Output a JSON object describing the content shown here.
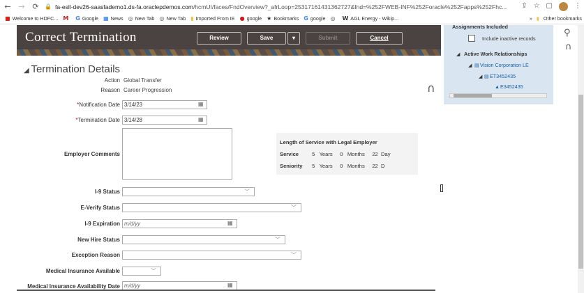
{
  "browser": {
    "url_prefix": "fa-esll-dev26-saasfademo1.ds-fa.oraclepdemos.com",
    "url_rest": "/hcmUI/faces/FndOverview?_afrLoop=25317161431362727&fnd=%252FWEB-INF%252Foracle%252Fapps%252Fhc...",
    "bookmarks": [
      {
        "label": "Welcome to HDFC...",
        "icon": "hdfc-icon",
        "color": "#d0271d"
      },
      {
        "label": "",
        "icon": "gmail-icon",
        "color": "#c5221f"
      },
      {
        "label": "Google",
        "icon": "google-icon",
        "color": "#4285f4"
      },
      {
        "label": "News",
        "icon": "news-icon",
        "color": "#1a73e8"
      },
      {
        "label": "New Tab",
        "icon": "globe-icon",
        "color": "#555555"
      },
      {
        "label": "New Tab",
        "icon": "globe-icon",
        "color": "#555555"
      },
      {
        "label": "Imported From IE",
        "icon": "folder-icon",
        "color": "#f4c242"
      },
      {
        "label": "google",
        "icon": "opera-icon",
        "color": "#cc1b1b"
      },
      {
        "label": "Bookmarks",
        "icon": "star-icon",
        "color": "#333333"
      },
      {
        "label": "google",
        "icon": "google-icon",
        "color": "#4285f4"
      },
      {
        "label": "",
        "icon": "globe-icon",
        "color": "#555555"
      },
      {
        "label": "AGL Energy - Wikip...",
        "icon": "wikipedia-icon",
        "color": "#333333"
      }
    ],
    "bookmarks_overflow": "»",
    "other_bookmarks": "Other bookmarks"
  },
  "header": {
    "title": "Correct Termination",
    "review": "Review",
    "save": "Save",
    "save_menu": "▾",
    "submit": "Submit",
    "cancel": "Cancel"
  },
  "panel": {
    "heading": "Assignments Included",
    "include_inactive": "Include inactive records",
    "active_work": "Active Work Relationships",
    "legal_employer": "Vision Corporation LE",
    "assignment1": "ET3452435",
    "assignment2": "E3452435"
  },
  "form": {
    "section_title": "Termination Details",
    "action_label": "Action",
    "action_value": "Global Transfer",
    "reason_label": "Reason",
    "reason_value": "Career Progression",
    "notification_label": "Notification Date",
    "notification_value": "3/14/23",
    "termination_label": "Termination Date",
    "termination_value": "3/14/28",
    "employer_comments_label": "Employer Comments",
    "i9_status_label": "I-9 Status",
    "everify_label": "E-Verify Status",
    "i9_expiration_label": "I-9 Expiration",
    "i9_expiration_placeholder": "m/d/yy",
    "new_hire_label": "New Hire Status",
    "exception_label": "Exception Reason",
    "medical_label": "Medical Insurance Available",
    "medical_date_label": "Medical Insurance Availability Date",
    "medical_date_placeholder": "m/d/yy",
    "required_mark": "*"
  },
  "length_of_service": {
    "title": "Length of Service with Legal Employer",
    "service_label": "Service",
    "service_years": "5",
    "service_months": "0",
    "service_days": "22",
    "seniority_label": "Seniority",
    "seniority_years": "5",
    "seniority_months": "0",
    "seniority_days": "22",
    "years_word": "Years",
    "months_word": "Months",
    "days_word_service": "Day",
    "days_word_seniority": "D"
  }
}
